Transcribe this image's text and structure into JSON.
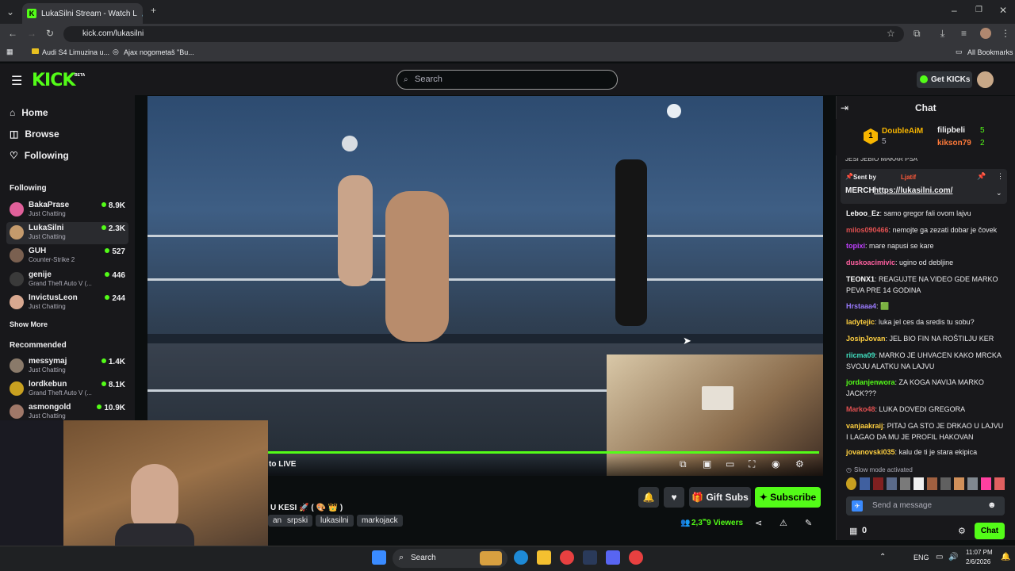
{
  "browser": {
    "tab_title": "LukaSilni Stream - Watch L",
    "url": "kick.com/lukasilni",
    "bookmarks": [
      "Audi S4 Limuzina u...",
      "Ajax nogometaš \"Bu..."
    ],
    "all_bookmarks": "All Bookmarks"
  },
  "header": {
    "logo": "KICK",
    "beta": "BETA",
    "search_placeholder": "Search",
    "get_kicks": "Get KICKs"
  },
  "nav": {
    "home": "Home",
    "browse": "Browse",
    "following": "Following"
  },
  "sidebar": {
    "following_title": "Following",
    "following": [
      {
        "name": "BakaPrase",
        "sub": "Just Chatting",
        "viewers": "8.9K",
        "color": "#e0609a"
      },
      {
        "name": "LukaSilni",
        "sub": "Just Chatting",
        "viewers": "2.3K",
        "color": "#c49a6c"
      },
      {
        "name": "GUH",
        "sub": "Counter-Strike 2",
        "viewers": "527",
        "color": "#7a6050"
      },
      {
        "name": "genije",
        "sub": "Grand Theft Auto V (...",
        "viewers": "446",
        "color": "#3a3a3a"
      },
      {
        "name": "InvictusLeon",
        "sub": "Just Chatting",
        "viewers": "244",
        "color": "#d8a890"
      }
    ],
    "show_more": "Show More",
    "recommended_title": "Recommended",
    "recommended": [
      {
        "name": "messymaj",
        "sub": "Just Chatting",
        "viewers": "1.4K",
        "color": "#8a7a6a"
      },
      {
        "name": "lordkebun",
        "sub": "Grand Theft Auto V (...",
        "viewers": "8.1K",
        "color": "#c8a020"
      },
      {
        "name": "asmongold",
        "sub": "Just Chatting",
        "viewers": "10.9K",
        "color": "#a07868"
      }
    ]
  },
  "video": {
    "live_text": "to LIVE",
    "title_partial": "U KESI 🚀 ( 🎨 👑 )"
  },
  "stream": {
    "tags": [
      "an",
      "srpski",
      "lukasilni",
      "markojack"
    ],
    "gift_subs": "Gift Subs",
    "subscribe": "Subscribe",
    "viewers": "2,3‷9 Viewers"
  },
  "chat": {
    "title": "Chat",
    "leaders": [
      {
        "name": "DoubleAiM",
        "count": "5",
        "rank": "1"
      },
      {
        "name": "filipbeli",
        "count": "5"
      },
      {
        "name": "kikson79",
        "count": "2"
      }
    ],
    "partial_line": "JESI JEBIO MAKAR PSA",
    "pinned_by_label": "Sent by",
    "pinned_by": "Ljatif",
    "pinned_text": "MERCH",
    "pinned_link": "https://lukasilni.com/",
    "messages": [
      {
        "user": "Leboo_Ez",
        "color": "#ffffff",
        "text": "samo gregor fali ovom lajvu"
      },
      {
        "user": "milos090466",
        "color": "#e05050",
        "text": "nemojte ga zezati dobar je čovek"
      },
      {
        "user": "topixi",
        "color": "#c040ff",
        "text": "mare napusi se kare"
      },
      {
        "user": "duskoacimivic",
        "color": "#ff60a0",
        "text": "ugino od debljine"
      },
      {
        "user": "TEONX1",
        "color": "#ffffff",
        "text": "REAGUJTE NA VIDEO GDE MARKO PEVA PRE 14 GODINA"
      },
      {
        "user": "Hrstaaa4",
        "color": "#9b7bff",
        "text": "🟩"
      },
      {
        "user": "ladytejic",
        "color": "#ffd040",
        "text": "luka jel ces da sredis tu sobu?"
      },
      {
        "user": "JosipJovan",
        "color": "#ffd040",
        "text": "JEL BIO FIN NA ROŠTILJU KER"
      },
      {
        "user": "riicma09",
        "color": "#40e0c0",
        "text": "MARKO JE UHVACEN KAKO MRCKA SVOJU ALATKU NA LAJVU"
      },
      {
        "user": "jordanjenwora",
        "color": "#53fc18",
        "text": "ZA KOGA NAVIJA MARKO JACK???"
      },
      {
        "user": "Marko48",
        "color": "#e05050",
        "text": "LUKA DOVEDI GREGORA"
      },
      {
        "user": "vanjaakraij",
        "color": "#ffd040",
        "text": "PITAJ GA STO JE DRKAO U LAJVU I LAGAO DA MU JE PROFIL HAKOVAN"
      },
      {
        "user": "jovanovski035",
        "color": "#ffd040",
        "text": "kalu de ti je stara ekipica"
      }
    ],
    "slow_mode": "Slow mode activated",
    "send_placeholder": "Send a message",
    "points": "0",
    "chat_button": "Chat"
  },
  "taskbar": {
    "search": "Search",
    "lang": "ENG",
    "time": "11:07 PM",
    "date": "2/6/2026"
  }
}
